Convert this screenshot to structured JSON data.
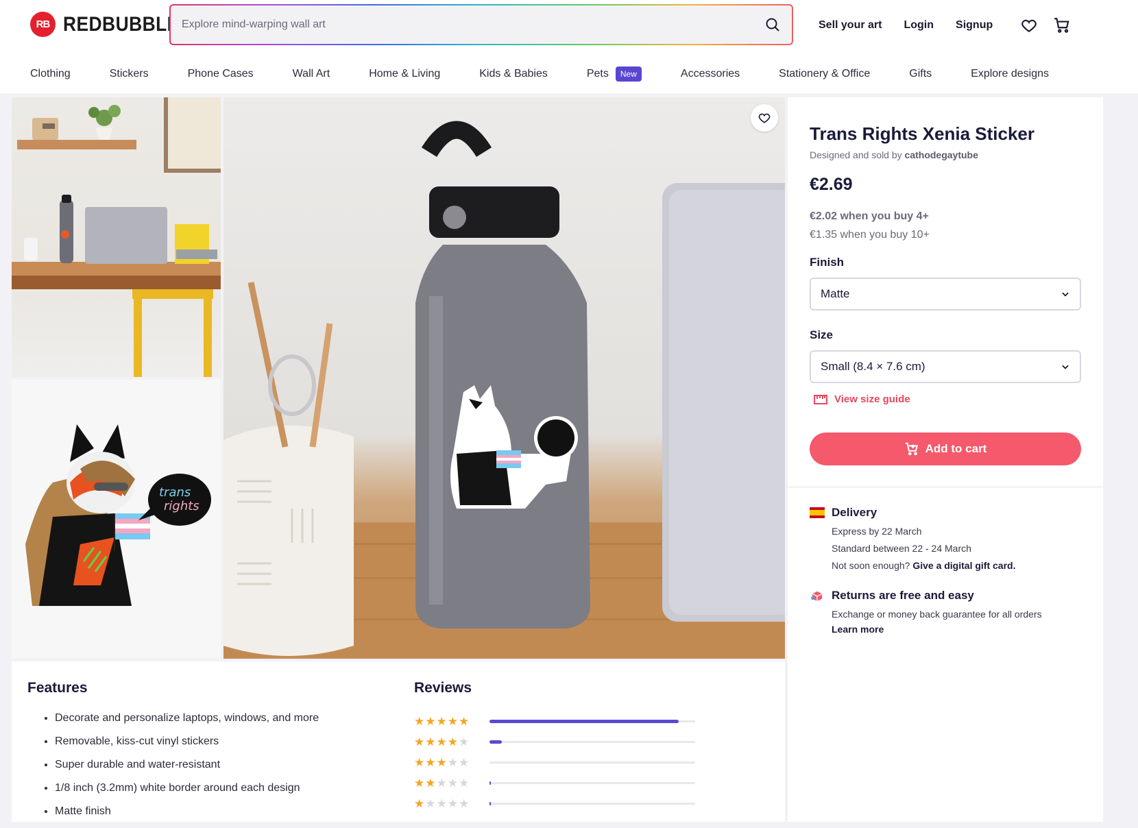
{
  "brand": {
    "logo_badge": "RB",
    "logo_text": "REDBUBBLE"
  },
  "search": {
    "placeholder": "Explore mind-warping wall art"
  },
  "top_links": {
    "sell": "Sell your art",
    "login": "Login",
    "signup": "Signup"
  },
  "nav": [
    {
      "label": "Clothing"
    },
    {
      "label": "Stickers"
    },
    {
      "label": "Phone Cases"
    },
    {
      "label": "Wall Art"
    },
    {
      "label": "Home & Living"
    },
    {
      "label": "Kids & Babies"
    },
    {
      "label": "Pets",
      "badge": "New"
    },
    {
      "label": "Accessories"
    },
    {
      "label": "Stationery & Office"
    },
    {
      "label": "Gifts"
    },
    {
      "label": "Explore designs"
    }
  ],
  "product": {
    "title": "Trans Rights Xenia Sticker",
    "seller_prefix": "Designed and sold by",
    "seller": "cathodegaytube",
    "price": "€2.69",
    "bulk_4": "€2.02 when you buy 4+",
    "bulk_10": "€1.35 when you buy 10+",
    "finish_label": "Finish",
    "finish_value": "Matte",
    "size_label": "Size",
    "size_value": "Small (8.4 × 7.6 cm)",
    "size_guide": "View size guide",
    "add_to_cart": "Add to cart",
    "sticker_text": "trans rights"
  },
  "delivery": {
    "title": "Delivery",
    "express": "Express by 22 March",
    "standard": "Standard between 22 - 24 March",
    "soon_prefix": "Not soon enough?",
    "soon_link": "Give a digital gift card."
  },
  "returns": {
    "title": "Returns are free and easy",
    "text": "Exchange or money back guarantee for all orders",
    "link": "Learn more"
  },
  "features": {
    "title": "Features",
    "items": [
      "Decorate and personalize laptops, windows, and more",
      "Removable, kiss-cut vinyl stickers",
      "Super durable and water-resistant",
      "1/8 inch (3.2mm) white border around each design",
      "Matte finish"
    ]
  },
  "reviews": {
    "title": "Reviews",
    "rows": [
      {
        "stars": 5,
        "fraction": 0.92
      },
      {
        "stars": 4,
        "fraction": 0.06
      },
      {
        "stars": 3,
        "fraction": 0.0
      },
      {
        "stars": 2,
        "fraction": 0.005
      },
      {
        "stars": 1,
        "fraction": 0.005
      }
    ]
  },
  "colors": {
    "accent": "#f5596c",
    "brand_red": "#e4202e",
    "purple": "#5846d1",
    "star": "#f5a623"
  }
}
